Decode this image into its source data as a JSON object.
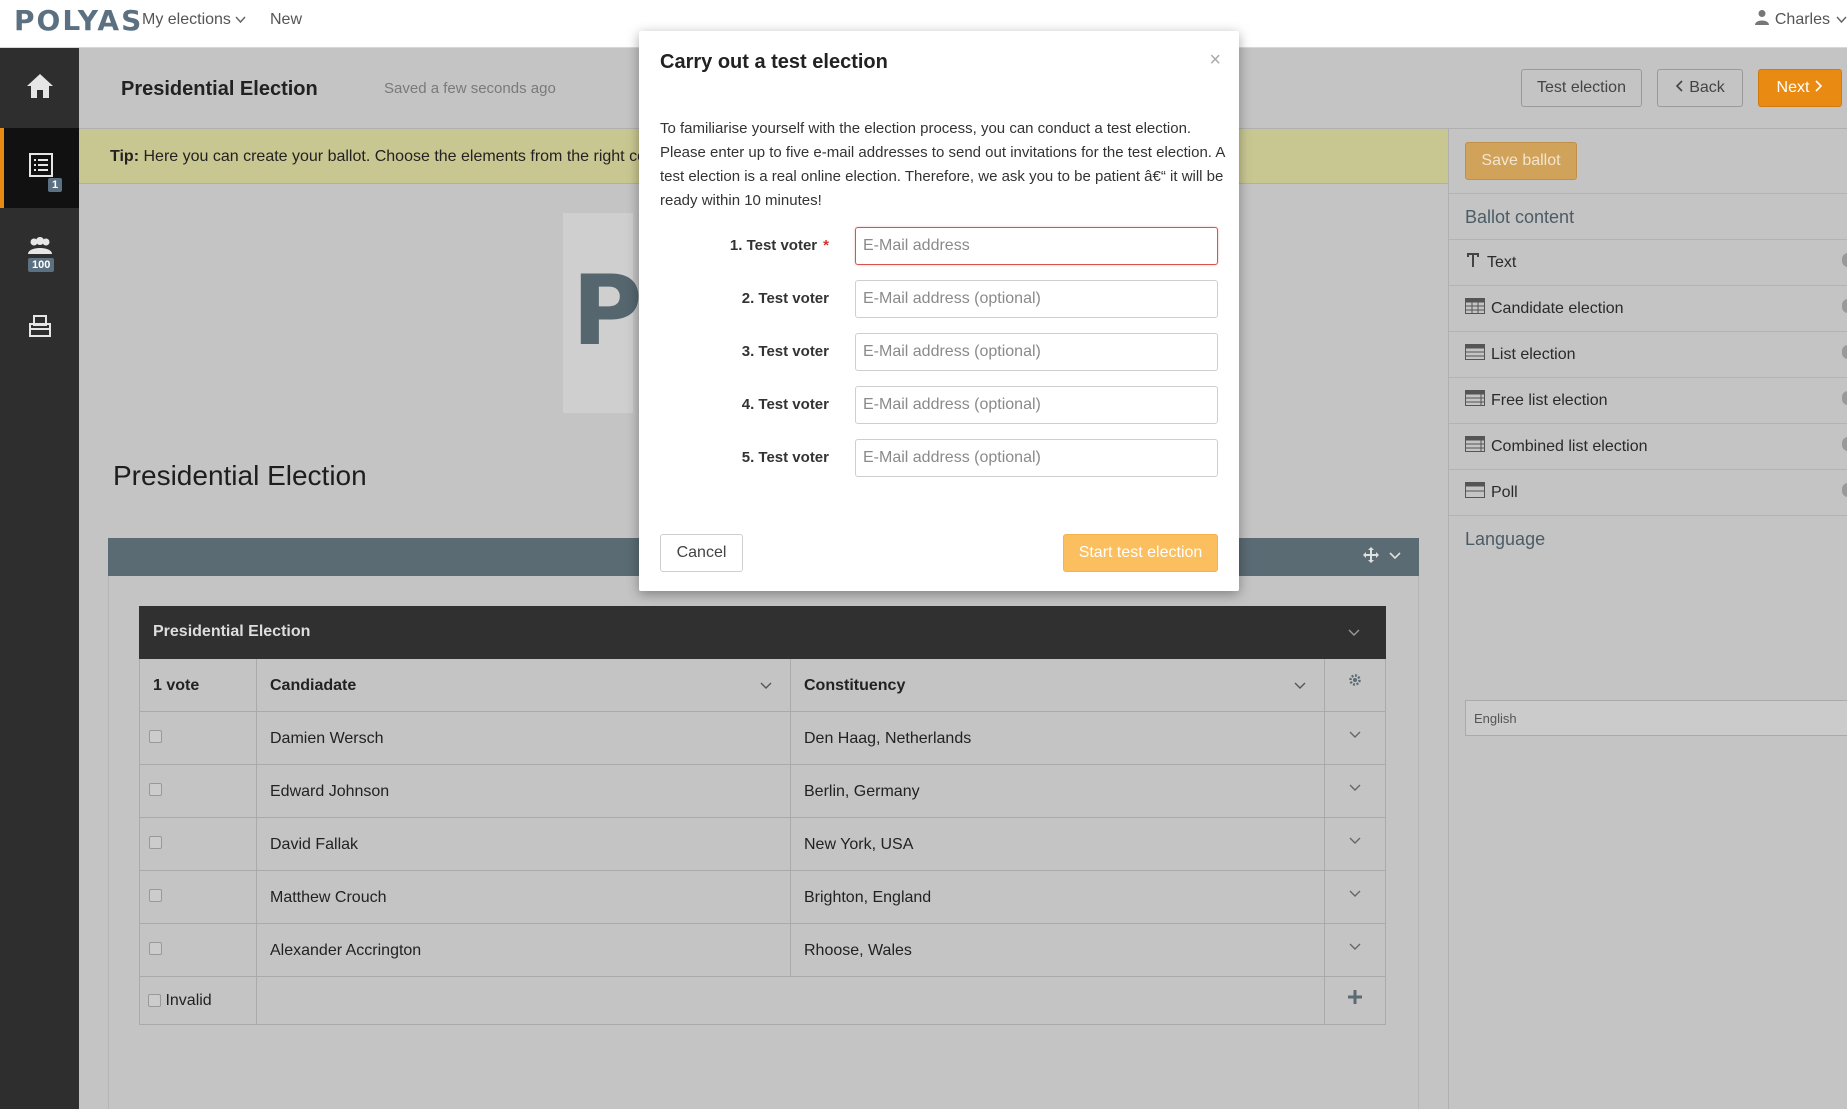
{
  "topnav": {
    "logo": "POLYAS",
    "my_elections": "My elections",
    "new": "New",
    "user": "Charles"
  },
  "sidebar": {
    "ballot_badge": "1",
    "voters_badge": "100"
  },
  "header": {
    "title": "Presidential Election",
    "saved_status": "Saved a few seconds ago",
    "test_election": "Test election",
    "back": "Back",
    "next": "Next"
  },
  "tip": {
    "prefix": "Tip:",
    "text": "Here you can create your ballot. Choose the elements from the right column"
  },
  "canvas": {
    "logo_letter": "P",
    "heading": "Presidential Election"
  },
  "ballot_table": {
    "title": "Presidential Election",
    "columns": [
      "1 vote",
      "Candiadate",
      "Constituency"
    ],
    "rows": [
      {
        "candidate": "Damien Wersch",
        "constituency": "Den Haag, Netherlands"
      },
      {
        "candidate": "Edward Johnson",
        "constituency": "Berlin, Germany"
      },
      {
        "candidate": "David Fallak",
        "constituency": "New York, USA"
      },
      {
        "candidate": "Matthew Crouch",
        "constituency": "Brighton, England"
      },
      {
        "candidate": "Alexander Accrington",
        "constituency": "Rhoose, Wales"
      }
    ],
    "invalid_label": "Invalid"
  },
  "right_sidebar": {
    "save_ballot": "Save ballot",
    "ballot_content": "Ballot content",
    "items": [
      "Text",
      "Candidate election",
      "List election",
      "Free list election",
      "Combined list election",
      "Poll"
    ],
    "language": "Language",
    "language_value": "English"
  },
  "modal": {
    "title": "Carry out a test election",
    "close": "×",
    "description": "To familiarise yourself with the election process, you can conduct a test election. Please enter up to five e-mail addresses to send out invitations for the test election. A test election is a real online election. Therefore, we ask you to be patient â€“ it will be ready within 10 minutes!",
    "fields": [
      {
        "label": "1. Test voter",
        "placeholder": "E-Mail address",
        "required": "*"
      },
      {
        "label": "2. Test voter",
        "placeholder": "E-Mail address (optional)"
      },
      {
        "label": "3. Test voter",
        "placeholder": "E-Mail address (optional)"
      },
      {
        "label": "4. Test voter",
        "placeholder": "E-Mail address (optional)"
      },
      {
        "label": "5. Test voter",
        "placeholder": "E-Mail address (optional)"
      }
    ],
    "cancel": "Cancel",
    "start": "Start test election"
  },
  "colors": {
    "brand_orange": "#e98a12",
    "slate": "#5b7080",
    "tip_bg": "#c9c791"
  }
}
